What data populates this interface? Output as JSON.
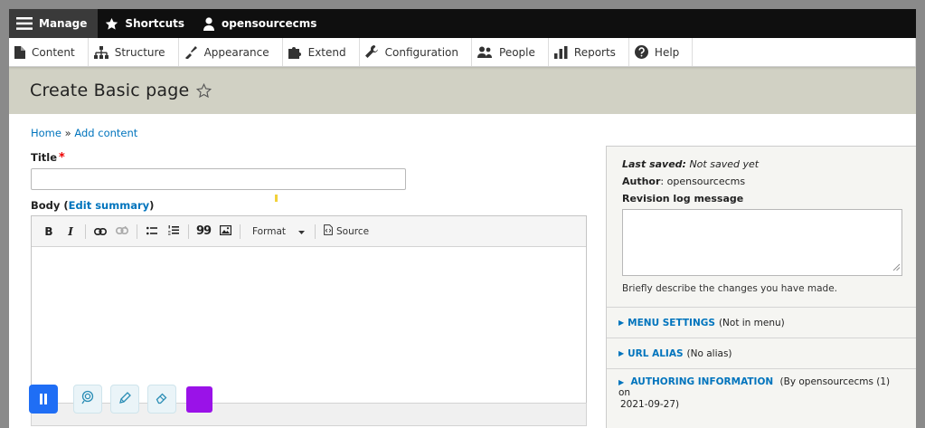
{
  "toolbar": {
    "manage": "Manage",
    "shortcuts": "Shortcuts",
    "user": "opensourcecms"
  },
  "tray": {
    "items": [
      {
        "label": "Content",
        "icon": "document-icon"
      },
      {
        "label": "Structure",
        "icon": "sitemap-icon"
      },
      {
        "label": "Appearance",
        "icon": "paintbrush-icon"
      },
      {
        "label": "Extend",
        "icon": "puzzle-icon"
      },
      {
        "label": "Configuration",
        "icon": "wrench-icon"
      },
      {
        "label": "People",
        "icon": "people-icon"
      },
      {
        "label": "Reports",
        "icon": "bar-chart-icon"
      },
      {
        "label": "Help",
        "icon": "help-icon"
      }
    ]
  },
  "page": {
    "title": "Create Basic page",
    "breadcrumb_home": "Home",
    "breadcrumb_sep": " » ",
    "breadcrumb_add": "Add content"
  },
  "form": {
    "title_label": "Title",
    "required_marker": "*",
    "title_value": "",
    "body_label": "Body",
    "body_open": " (",
    "edit_summary": "Edit summary",
    "body_close": ")"
  },
  "editor": {
    "bold": "B",
    "italic": "I",
    "blockquote": "99",
    "format_label": "Format",
    "source_label": "Source"
  },
  "sidebar": {
    "last_saved_label": "Last saved:",
    "last_saved_value": " Not saved yet",
    "author_label": "Author",
    "author_value": ": opensourcecms",
    "revision_label": "Revision log message",
    "revision_value": "",
    "revision_desc": "Briefly describe the changes you have made.",
    "menu_settings": "MENU SETTINGS",
    "menu_settings_note": "(Not in menu)",
    "url_alias": "URL ALIAS",
    "url_alias_note": "(No alias)",
    "authoring": "AUTHORING INFORMATION",
    "authoring_note_1": "(By opensourcecms (1) on",
    "authoring_note_2": "2021-09-27)"
  },
  "colors": {
    "link": "#0074bd",
    "header_bg": "#d1d1c4",
    "toolbar_bg": "#0f0f0f",
    "pause_button": "#1f6ef5",
    "color_swatch": "#9a12e8"
  }
}
